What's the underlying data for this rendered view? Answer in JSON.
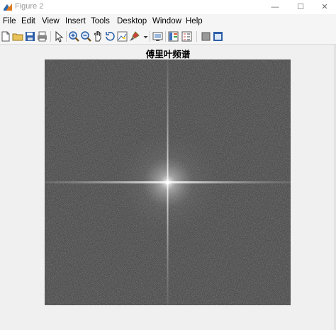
{
  "window": {
    "title": "Figure 2",
    "controls": {
      "minimize": "—",
      "maximize": "☐",
      "close": "✕"
    }
  },
  "menu": [
    "File",
    "Edit",
    "View",
    "Insert",
    "Tools",
    "Desktop",
    "Window",
    "Help"
  ],
  "toolbar": [
    "new-figure-icon",
    "open-file-icon",
    "save-icon",
    "print-icon",
    "edit-plot-arrow-icon",
    "zoom-in-icon",
    "zoom-out-icon",
    "pan-hand-icon",
    "rotate-3d-icon",
    "data-cursor-icon",
    "brush-icon",
    "link-plot-icon",
    "insert-colorbar-icon",
    "hide-plot-tools-icon",
    "show-plot-tools-icon"
  ],
  "plot": {
    "title": "傅里叶频谱"
  },
  "colors": {
    "spectrum_background": "#3c3c3c",
    "spectrum_center": "#ffffff",
    "window_background": "#f0f0f0"
  }
}
